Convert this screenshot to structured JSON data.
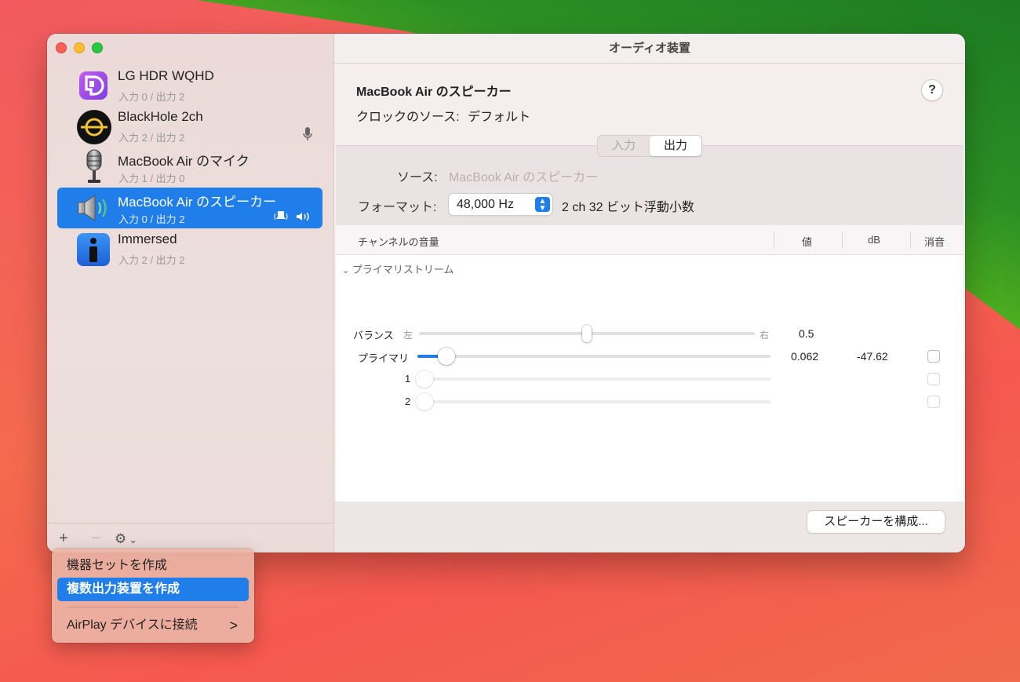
{
  "window": {
    "title": "オーディオ装置"
  },
  "sidebar": {
    "devices": [
      {
        "name": "LG HDR WQHD",
        "io": "入力 0 / 出力 2",
        "icon": "displayport-icon",
        "right": ""
      },
      {
        "name": "BlackHole 2ch",
        "io": "入力 2 / 出力 2",
        "icon": "blackhole-icon",
        "right": "🎙"
      },
      {
        "name": "MacBook Air のマイク",
        "io": "入力 1 / 出力 0",
        "icon": "microphone-icon",
        "right": ""
      },
      {
        "name": "MacBook Air のスピーカー",
        "io": "入力 0 / 出力 2",
        "icon": "speaker-icon",
        "right": "🔔 🔊"
      },
      {
        "name": "Immersed",
        "io": "入力 2 / 出力 2",
        "icon": "immersed-app-icon",
        "right": ""
      }
    ],
    "selected_index": 3,
    "add_label": "+",
    "remove_label": "−",
    "gear_label": "⚙",
    "gear_chevron": "⌄"
  },
  "detail": {
    "device_title": "MacBook Air のスピーカー",
    "clock_label": "クロックのソース:",
    "clock_value": "デフォルト",
    "help": "?",
    "tabs": {
      "input": "入力",
      "output": "出力",
      "active": "output"
    },
    "source_label": "ソース:",
    "source_value": "MacBook Air のスピーカー",
    "format_label": "フォーマット:",
    "format_rate": "48,000 Hz",
    "format_desc": "2 ch 32 ビット浮動小数"
  },
  "table": {
    "headers": {
      "channel": "チャンネルの音量",
      "value": "値",
      "db": "dB",
      "mute": "消音"
    },
    "group": "プライマリストリーム",
    "rows": [
      {
        "label": "バランス",
        "left": "左",
        "right": "右",
        "value": "0.5",
        "db": "",
        "level": 0.5,
        "mute": false
      },
      {
        "label": "プライマリ",
        "value": "0.062",
        "db": "-47.62",
        "level": 0.062,
        "mute": false
      },
      {
        "label": "1",
        "value": "",
        "db": "",
        "level": 0,
        "mute": false
      },
      {
        "label": "2",
        "value": "",
        "db": "",
        "level": 0,
        "mute": false
      }
    ]
  },
  "footer": {
    "configure_label": "スピーカーを構成..."
  },
  "menu": {
    "items": [
      {
        "label": "機器セットを作成"
      },
      {
        "label": "複数出力装置を作成"
      },
      {
        "label": "AirPlay デバイスに接続",
        "submenu": ">"
      }
    ],
    "highlighted_index": 1
  },
  "colors": {
    "accent": "#1f7ee9"
  }
}
